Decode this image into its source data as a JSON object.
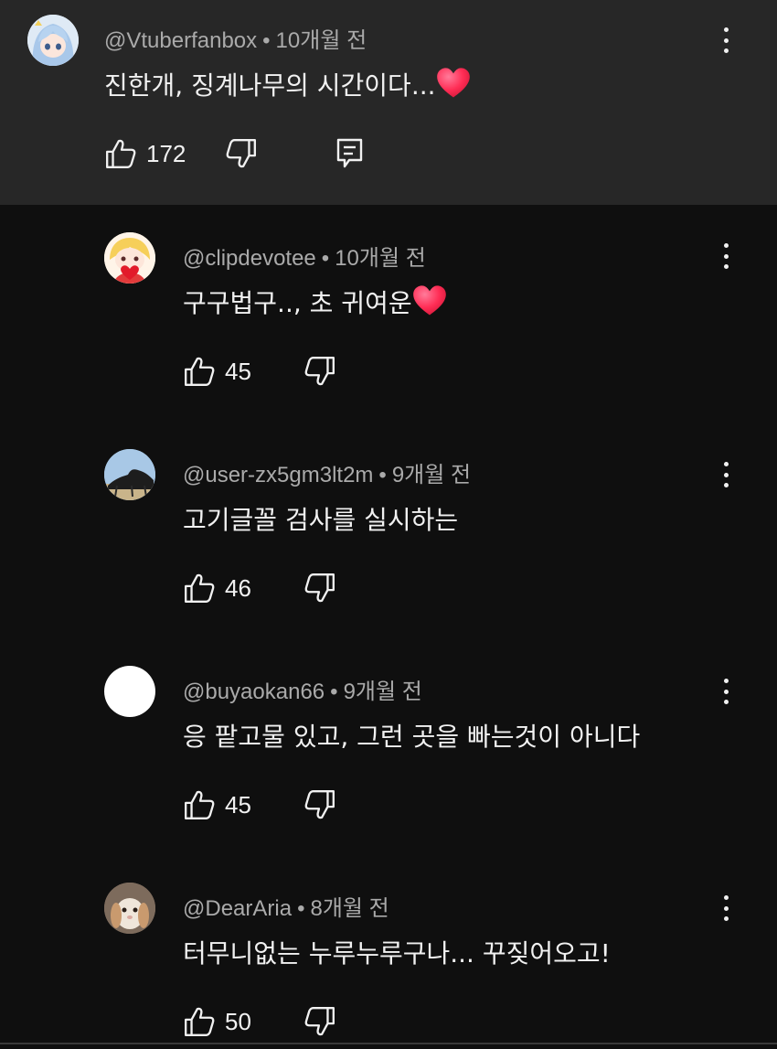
{
  "parent_comment": {
    "handle": "@Vtuberfanbox",
    "time": "10개월 전",
    "text": "진한개, 징계나무의 시간이다...",
    "emoji": "❤️",
    "likes": "172"
  },
  "replies": [
    {
      "handle": "@clipdevotee",
      "time": "10개월 전",
      "text": "구구법구.., 초 귀여운",
      "emoji": "❤️",
      "likes": "45"
    },
    {
      "handle": "@user-zx5gm3lt2m",
      "time": "9개월 전",
      "text": "고기글꼴 검사를 실시하는",
      "emoji": "",
      "likes": "46"
    },
    {
      "handle": "@buyaokan66",
      "time": "9개월 전",
      "text": "응 팥고물 있고, 그런 곳을 빠는것이 아니다",
      "emoji": "",
      "likes": "45"
    },
    {
      "handle": "@DearAria",
      "time": "8개월 전",
      "text": "터무니없는 누루누루구나... 꾸짖어오고!",
      "emoji": "",
      "likes": "50"
    }
  ],
  "separator": "•",
  "icons": [
    "thumbs-up-icon",
    "thumbs-down-icon",
    "reply-icon",
    "more-vert-icon",
    "heart-emoji"
  ],
  "colors": {
    "background": "#0f0f0f",
    "highlight": "#272727",
    "text": "#f1f1f1",
    "meta": "#aaaaaa",
    "heart": "#ff2d55"
  }
}
